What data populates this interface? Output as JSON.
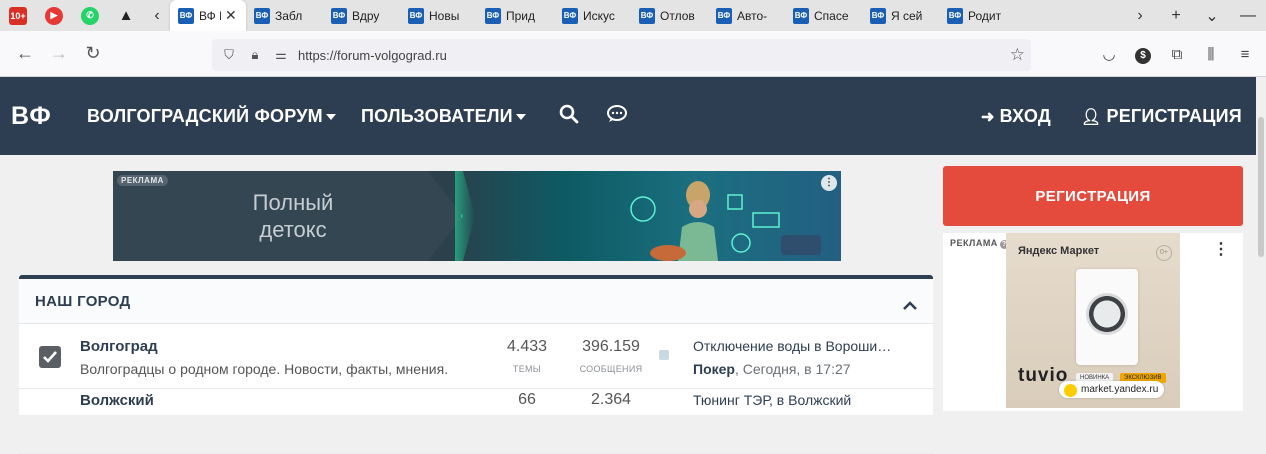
{
  "browser": {
    "pinned": [
      {
        "name": "gmail",
        "label": "10+",
        "color": "#d93025"
      },
      {
        "name": "youtube-music",
        "label": "▶",
        "color": "#e53935"
      },
      {
        "name": "whatsapp",
        "label": "✆",
        "color": "#25d366"
      },
      {
        "name": "warning",
        "label": "▲",
        "color": "#222222"
      }
    ],
    "tabs": [
      {
        "title": "ВФ Вол",
        "active": true
      },
      {
        "title": "Забл",
        "active": false
      },
      {
        "title": "Вдру",
        "active": false
      },
      {
        "title": "Новы",
        "active": false
      },
      {
        "title": "Прид",
        "active": false
      },
      {
        "title": "Искус",
        "active": false
      },
      {
        "title": "Отлов",
        "active": false
      },
      {
        "title": "Авто-",
        "active": false
      },
      {
        "title": "Спасе",
        "active": false
      },
      {
        "title": "Я сей",
        "active": false
      },
      {
        "title": "Родит",
        "active": false
      }
    ],
    "tab_favicon": "ВФ",
    "url": "https://forum-volgograd.ru"
  },
  "header": {
    "logo": "ВФ",
    "nav": [
      "ВОЛГОГРАДСКИЙ ФОРУМ",
      "ПОЛЬЗОВАТЕЛИ"
    ],
    "login": "ВХОД",
    "register": "РЕГИСТРАЦИЯ",
    "bg_color": "#2e3e52"
  },
  "ad_banner": {
    "label": "РЕКЛАМА",
    "text_line1": "Полный",
    "text_line2": "детокс"
  },
  "forum": {
    "section_title": "НАШ ГОРОД",
    "rows": [
      {
        "title": "Волгоград",
        "description": "Волгоградцы о родном городе. Новости, факты, мнения.",
        "threads": "4.433",
        "threads_label": "ТЕМЫ",
        "messages": "396.159",
        "messages_label": "СООБЩЕНИЯ",
        "last_title": "Отключение воды в Вороши…",
        "last_user": "Покер",
        "last_time": ", Сегодня, в 17:27"
      },
      {
        "title": "Волжский",
        "threads": "66",
        "messages": "2.364",
        "last_title": "Тюнинг ТЭР, в Волжский"
      }
    ]
  },
  "sidebar": {
    "register_button": "РЕГИСТРАЦИЯ",
    "register_color": "#e54b3c",
    "ad_label": "РЕКЛАМА",
    "ad_question": "?",
    "ad_market": "Яндекс Маркет",
    "ad_age": "0+",
    "ad_brand": "tuvio",
    "ad_badge_new": "НОВИНКА",
    "ad_badge_excl": "ЭКСКЛЮЗИВ",
    "ad_source": "market.yandex.ru"
  }
}
